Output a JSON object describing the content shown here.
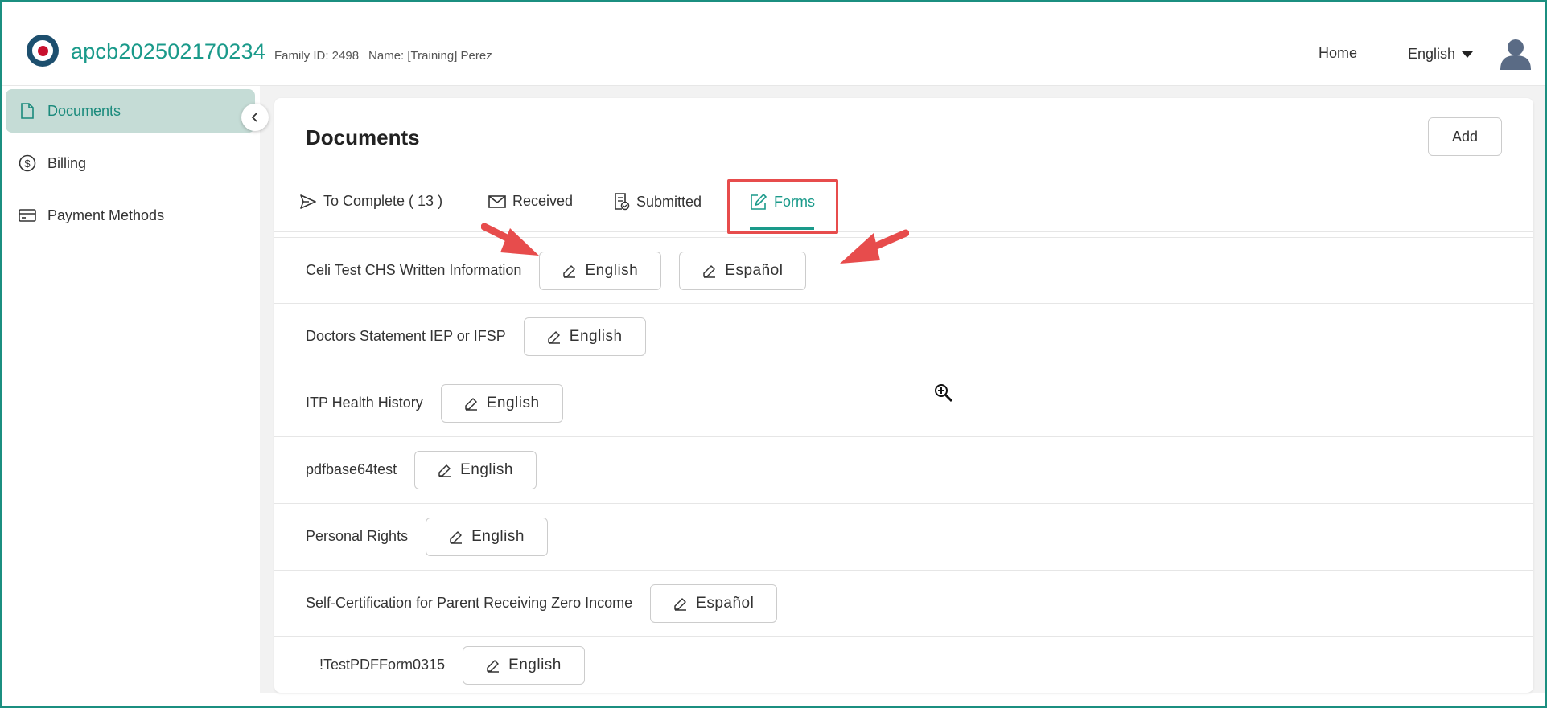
{
  "header": {
    "app_title": "apcb202502170234",
    "family_id": "Family ID: 2498",
    "name": "Name: [Training] Perez",
    "home_link": "Home",
    "language": "English"
  },
  "sidebar": {
    "items": [
      {
        "label": "Documents",
        "icon": "document-icon",
        "active": true
      },
      {
        "label": "Billing",
        "icon": "dollar-circle-icon",
        "active": false
      },
      {
        "label": "Payment Methods",
        "icon": "credit-card-icon",
        "active": false
      }
    ]
  },
  "main": {
    "title": "Documents",
    "add_label": "Add",
    "tabs": [
      {
        "label": "To Complete ( 13 )",
        "icon": "send-icon"
      },
      {
        "label": "Received",
        "icon": "envelope-icon"
      },
      {
        "label": "Submitted",
        "icon": "submitted-doc-icon"
      },
      {
        "label": "Forms",
        "icon": "edit-icon",
        "active": true
      }
    ],
    "forms": [
      {
        "name": "Celi Test CHS Written Information",
        "buttons": [
          "English",
          "Español"
        ]
      },
      {
        "name": "Doctors Statement IEP or IFSP",
        "buttons": [
          "English"
        ]
      },
      {
        "name": "ITP Health History",
        "buttons": [
          "English"
        ]
      },
      {
        "name": "pdfbase64test",
        "buttons": [
          "English"
        ]
      },
      {
        "name": "Personal Rights",
        "buttons": [
          "English"
        ]
      },
      {
        "name": "Self-Certification for Parent Receiving Zero Income",
        "buttons": [
          "Español"
        ]
      },
      {
        "name": "!TestPDFForm0315",
        "buttons": [
          "English"
        ]
      }
    ]
  },
  "colors": {
    "accent": "#1a9a8a",
    "active_sidebar_bg": "#c5dcd6",
    "annotation_red": "#e74c4c",
    "frame_border": "#1b8f80"
  }
}
